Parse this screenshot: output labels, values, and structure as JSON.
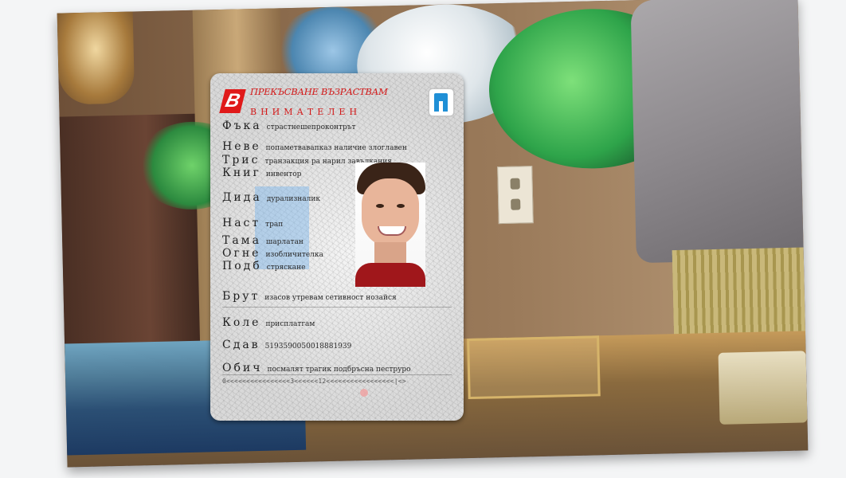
{
  "card": {
    "header_title": "ПРЕКЪСВАНЕ ВЪЗРАСТВАМ",
    "subtitle": "ВНИМАТЕЛЕН",
    "fields": [
      {
        "label": "Фъка",
        "value": "страстнешепроконтрът"
      },
      {
        "label": "Неве",
        "value": "попаметвавапказ наличие злоглавен"
      },
      {
        "label": "Трис",
        "value": "транзакция ра нарил завълкания"
      },
      {
        "label": "Книг",
        "value": "инвентор"
      },
      {
        "label": "Дида",
        "value": "дурализналик"
      },
      {
        "label": "Наст",
        "value": "трап"
      },
      {
        "label": "Тама",
        "value": "шарлатан"
      },
      {
        "label": "Огне",
        "value": "изобличителка"
      },
      {
        "label": "Подб",
        "value": "стряскане"
      },
      {
        "label": "Брут",
        "value": "изасов утревам сетивност нозайся"
      },
      {
        "label": "Коле",
        "value": "присплатгам"
      },
      {
        "label": "Сдав",
        "value": "5193590050018881939"
      },
      {
        "label": "Обич",
        "value": "посмалят трагик подбръсна пеструро"
      }
    ],
    "mrz": "0<<<<<<<<<<<<<<<<3<<<<<<12<<<<<<<<<<<<<<<<<|<>"
  },
  "colors": {
    "accent_red": "#d21818",
    "badge_blue": "#1f8fd6"
  },
  "icons": {
    "logo": "b-logo-icon",
    "badge": "shorts-badge-icon"
  }
}
